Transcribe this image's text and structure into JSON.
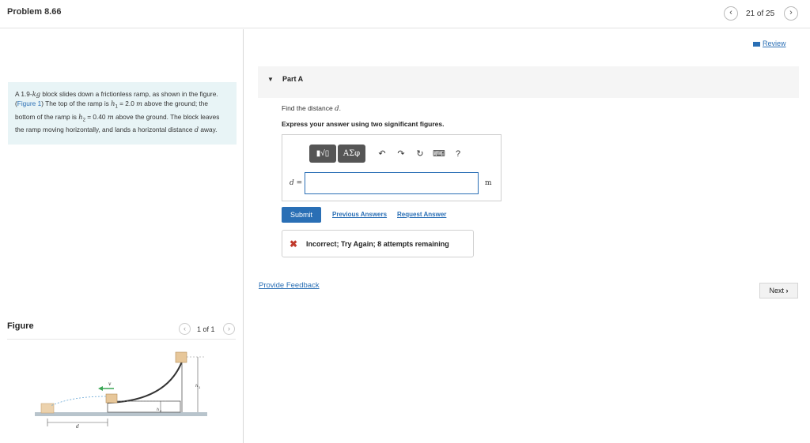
{
  "header": {
    "problem_title": "Problem 8.66",
    "prev_icon": "chevron-left-icon",
    "next_icon": "chevron-right-icon",
    "page_count": "21 of 25"
  },
  "problem": {
    "text_1": "A 1.9-",
    "kg": "kg",
    "text_2": " block slides down a frictionless ramp, as shown in the figure. (",
    "figure_link": "Figure 1",
    "text_3": ") The top of the ramp is ",
    "h1": "h",
    "h1_sub": "1",
    "text_4": " = 2.0 ",
    "m1": "m",
    "text_5": " above the ground; the bottom of the ramp is ",
    "h2": "h",
    "h2_sub": "2",
    "text_6": " = 0.40 ",
    "m2": "m",
    "text_7": " above the ground. The block leaves the ramp moving horizontally, and lands a horizontal distance ",
    "d": "d",
    "text_8": " away."
  },
  "figure": {
    "label": "Figure",
    "count": "1 of 1",
    "labels": {
      "v": "v",
      "h1": "h",
      "h1_sub": "1",
      "h2": "h",
      "h2_sub": "2",
      "d": "d"
    }
  },
  "review": {
    "label": "Review"
  },
  "part": {
    "arrow": "▼",
    "title": "Part A",
    "question": "Find the distance ",
    "question_var": "d",
    "question_end": ".",
    "instruction": "Express your answer using two significant figures."
  },
  "answer": {
    "toolbar": {
      "template_label": "▮√▯",
      "greek_label": "ΑΣφ",
      "undo": "↶",
      "redo": "↷",
      "reset": "↻",
      "keyboard": "⌨",
      "help": "?"
    },
    "var_label": "d =",
    "value": "",
    "unit": "m"
  },
  "actions": {
    "submit": "Submit",
    "previous_answers": "Previous Answers",
    "request_answer": "Request Answer"
  },
  "feedback": {
    "icon": "x-icon",
    "message": "Incorrect; Try Again; 8 attempts remaining"
  },
  "footer": {
    "provide_feedback": "Provide Feedback",
    "next": "Next"
  },
  "colors": {
    "accent": "#2a6fb5",
    "error": "#c0392b",
    "problem_bg": "#e8f4f6"
  }
}
